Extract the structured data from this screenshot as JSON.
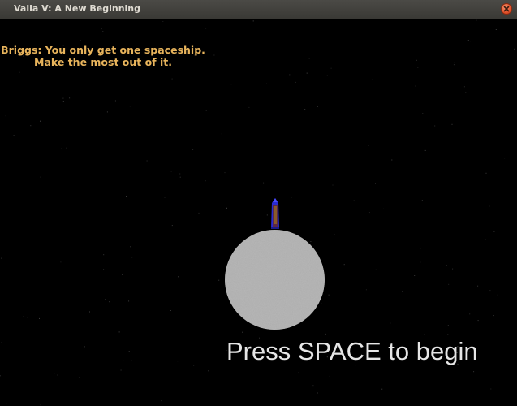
{
  "window": {
    "title": "Valia V: A New Beginning"
  },
  "game": {
    "dialog_line_1": "Briggs: You only get one spaceship.",
    "dialog_line_2": "Make the most out of it.",
    "prompt": "Press SPACE to begin"
  },
  "colors": {
    "background": "#000000",
    "dialog_text": "#e8b45c",
    "prompt_text": "#e6e6e6",
    "planet": "#adadad",
    "ship_body": "#2a2ac8",
    "ship_core": "#7a2a3a"
  },
  "icons": {
    "close": "close-icon"
  }
}
